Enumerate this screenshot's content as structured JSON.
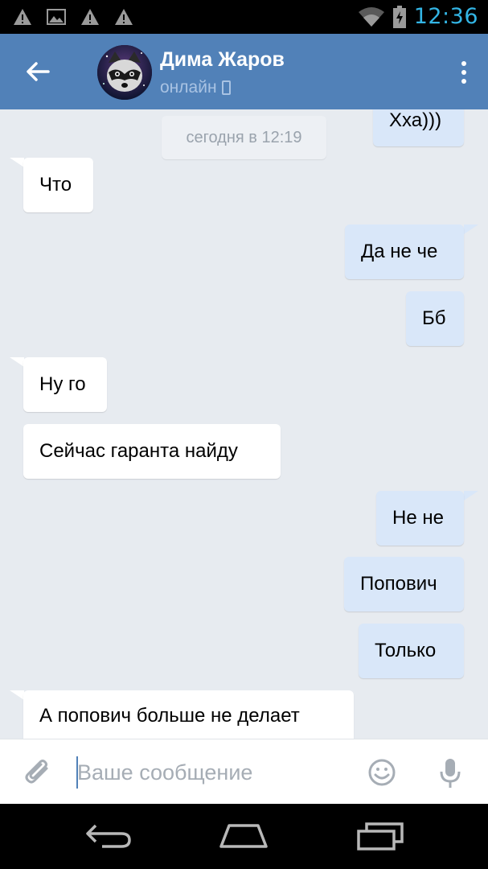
{
  "status_bar": {
    "time": "12:36",
    "left_icons": [
      "warning-icon",
      "image-icon",
      "warning-icon",
      "warning-icon"
    ],
    "right_icons": [
      "wifi-icon",
      "battery-charging-icon"
    ]
  },
  "header": {
    "contact_name": "Дима Жаров",
    "status": "онлайн",
    "accent_color": "#5181b8"
  },
  "chat": {
    "date_separator": "сегодня в 12:19",
    "messages": [
      {
        "direction": "out",
        "text": "Хха)))"
      },
      {
        "direction": "in",
        "text": "Что"
      },
      {
        "direction": "out",
        "text": "Да не че"
      },
      {
        "direction": "out",
        "text": "Бб"
      },
      {
        "direction": "in",
        "text": "Ну го"
      },
      {
        "direction": "in",
        "text": "Сейчас гаранта найду"
      },
      {
        "direction": "out",
        "text": "Не не"
      },
      {
        "direction": "out",
        "text": "Попович"
      },
      {
        "direction": "out",
        "text": "Только"
      },
      {
        "direction": "in",
        "text": "А попович больше не делает"
      }
    ]
  },
  "input_bar": {
    "placeholder": "Ваше сообщение",
    "value": ""
  },
  "nav_bar": {
    "buttons": [
      "back-icon",
      "home-icon",
      "recents-icon"
    ]
  }
}
